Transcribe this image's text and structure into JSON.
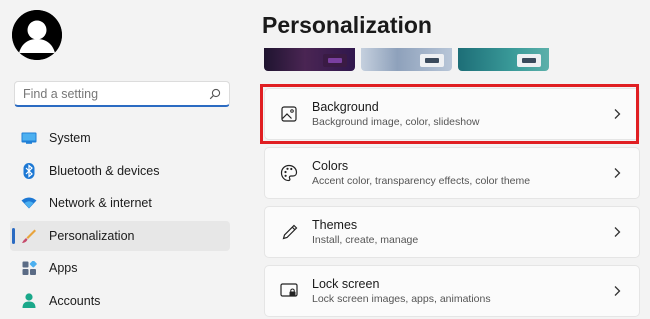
{
  "search": {
    "placeholder": "Find a setting"
  },
  "sidebar": {
    "items": [
      {
        "label": "System",
        "icon": "monitor-icon",
        "active": false
      },
      {
        "label": "Bluetooth & devices",
        "icon": "bluetooth-icon",
        "active": false
      },
      {
        "label": "Network & internet",
        "icon": "wifi-icon",
        "active": false
      },
      {
        "label": "Personalization",
        "icon": "brush-icon",
        "active": true
      },
      {
        "label": "Apps",
        "icon": "apps-icon",
        "active": false
      },
      {
        "label": "Accounts",
        "icon": "person-icon",
        "active": false
      }
    ]
  },
  "main": {
    "title": "Personalization",
    "cards": [
      {
        "title": "Background",
        "subtitle": "Background image, color, slideshow",
        "icon": "image-icon"
      },
      {
        "title": "Colors",
        "subtitle": "Accent color, transparency effects, color theme",
        "icon": "palette-icon"
      },
      {
        "title": "Themes",
        "subtitle": "Install, create, manage",
        "icon": "pen-icon"
      },
      {
        "title": "Lock screen",
        "subtitle": "Lock screen images, apps, animations",
        "icon": "lock-screen-icon"
      }
    ]
  },
  "colors": {
    "accent": "#2b6bc2",
    "highlight": "#e01e22"
  }
}
